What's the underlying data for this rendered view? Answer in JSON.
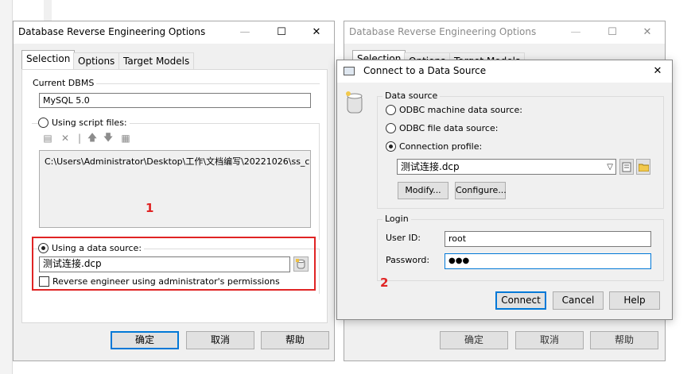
{
  "left_dialog": {
    "title": "Database Reverse Engineering Options",
    "tabs": [
      "Selection",
      "Options",
      "Target Models"
    ],
    "current_dbms_label": "Current DBMS",
    "current_dbms_value": "MySQL 5.0",
    "script_files_label": "Using script files:",
    "script_file_path": "C:\\Users\\Administrator\\Desktop\\工作\\文档编写\\20221026\\ss_co...",
    "data_source_label": "Using a data source:",
    "data_source_value": "测试连接.dcp",
    "admin_permissions_label": "Reverse engineer using administrator's permissions",
    "ok": "确定",
    "cancel": "取消",
    "help": "帮助"
  },
  "right_dialog_bg": {
    "title": "Database Reverse Engineering Options",
    "tabs": [
      "Selection",
      "Options",
      "Target Models"
    ],
    "ok": "确定",
    "cancel": "取消",
    "help": "帮助"
  },
  "connect_dialog": {
    "title": "Connect to a Data Source",
    "data_source_group": "Data source",
    "odbc_machine": "ODBC machine data source:",
    "odbc_file": "ODBC file data source:",
    "connection_profile": "Connection profile:",
    "profile_value": "测试连接.dcp",
    "modify": "Modify...",
    "configure": "Configure...",
    "login_group": "Login",
    "user_id_label": "User ID:",
    "user_id_value": "root",
    "password_label": "Password:",
    "password_value": "●●●",
    "connect": "Connect",
    "cancel": "Cancel",
    "help": "Help"
  },
  "annotations": {
    "marker1": "1",
    "marker2": "2"
  },
  "colors": {
    "highlight": "#e02424",
    "accent": "#0078d7",
    "dialog_bg": "#f0f0f0"
  }
}
